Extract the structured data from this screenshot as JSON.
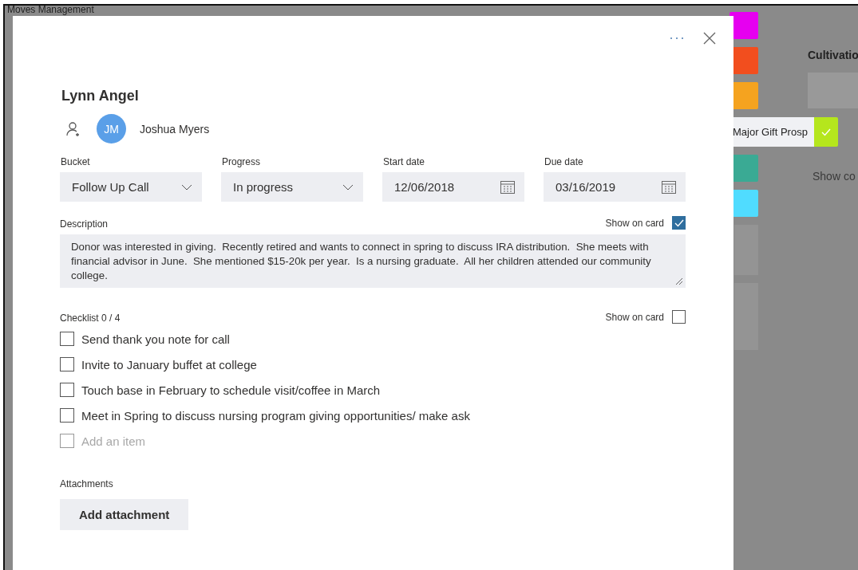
{
  "background": {
    "header_title": "Moves Management",
    "column_title": "Cultivatio",
    "column_link": "Show co"
  },
  "labels": [
    {
      "color": "#e600f0",
      "selected": false
    },
    {
      "color": "#f24e1e",
      "selected": false
    },
    {
      "color": "#f5a31f",
      "selected": false
    },
    {
      "color": "#b5e61d",
      "selected": true,
      "name": "Major Gift Prosp"
    },
    {
      "color": "#3aaa94",
      "selected": false
    },
    {
      "color": "#50dcff",
      "selected": false
    }
  ],
  "dialog": {
    "title": "Lynn Angel",
    "assignees": [
      {
        "initials": "JM",
        "name": "Joshua Myers"
      }
    ],
    "fields": [
      {
        "label": "Bucket",
        "value": "Follow Up Call",
        "kind": "dropdown"
      },
      {
        "label": "Progress",
        "value": "In progress",
        "kind": "dropdown"
      },
      {
        "label": "Start date",
        "value": "12/06/2018",
        "kind": "date"
      },
      {
        "label": "Due date",
        "value": "03/16/2019",
        "kind": "date"
      }
    ],
    "description": {
      "label": "Description",
      "show_on_card_label": "Show on card",
      "show_on_card": true,
      "value": "Donor was interested in giving.  Recently retired and wants to connect in spring to discuss IRA distribution.  She meets with financial advisor in June.  She mentioned $15-20k per year.  Is a nursing graduate.  All her children attended our community college."
    },
    "checklist": {
      "label": "Checklist 0 / 4",
      "show_on_card_label": "Show on card",
      "show_on_card": false,
      "items": [
        {
          "text": "Send thank you note for call",
          "checked": false
        },
        {
          "text": "Invite to January buffet at college",
          "checked": false
        },
        {
          "text": "Touch base in February to schedule visit/coffee in March",
          "checked": false
        },
        {
          "text": "Meet in Spring to discuss nursing program giving opportunities/ make ask",
          "checked": false
        }
      ],
      "add_placeholder": "Add an item",
      "add_item_checked": false
    },
    "attachments": {
      "label": "Attachments",
      "button": "Add attachment"
    }
  }
}
